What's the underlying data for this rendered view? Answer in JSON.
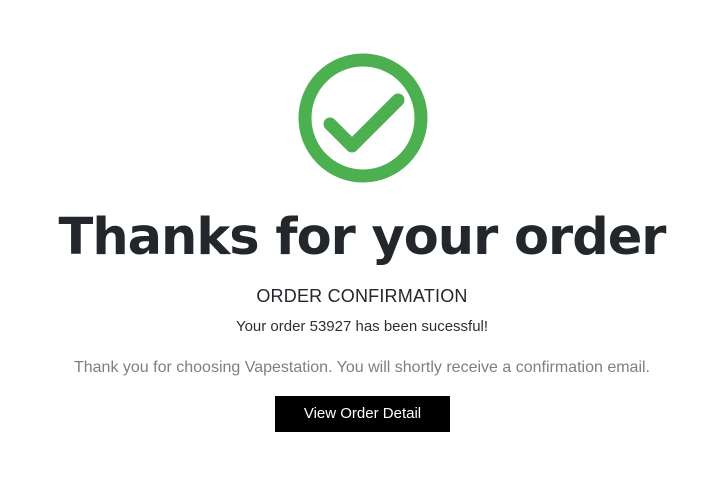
{
  "icon": {
    "name": "check-circle-icon",
    "color": "#4caf50"
  },
  "headline": "Thanks for your order",
  "confirmation": {
    "title": "ORDER CONFIRMATION",
    "order_message": "Your order 53927 has been sucessful!",
    "thanks_message": "Thank you for choosing Vapestation. You will shortly receive a confirmation email."
  },
  "actions": {
    "view_order_label": "View Order Detail"
  },
  "colors": {
    "heading": "#23272b",
    "muted_text": "#7a8087",
    "button_bg": "#000000",
    "button_text": "#ffffff"
  }
}
